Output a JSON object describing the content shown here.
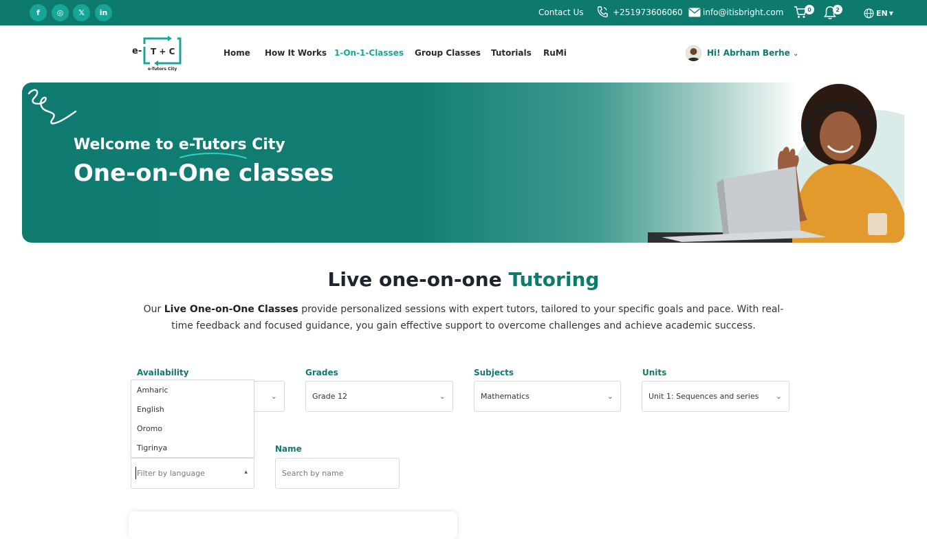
{
  "topbar": {
    "social": [
      {
        "icon": "facebook-icon",
        "glyph": "f"
      },
      {
        "icon": "instagram-icon",
        "glyph": "◎"
      },
      {
        "icon": "x-twitter-icon",
        "glyph": "𝕏"
      },
      {
        "icon": "linkedin-icon",
        "glyph": "in"
      }
    ],
    "contact_label": "Contact Us",
    "phone": "+251973606060",
    "email": "info@itisbright.com",
    "cart_count": "0",
    "notification_count": "2",
    "language": "EN"
  },
  "nav": {
    "logo_letters": "T + C",
    "logo_prefix": "e-",
    "logo_caption": "e-Tutors City",
    "items": [
      "Home",
      "How It Works",
      "1-On-1-Classes",
      "Group Classes",
      "Tutorials",
      "RuMi"
    ],
    "active_item": "1-On-1-Classes",
    "user_greeting": "Hi! Abrham Berhe"
  },
  "hero": {
    "welcome_prefix": "Welcome to ",
    "welcome_brand": "e-Tutors",
    "welcome_suffix": " City",
    "title": "One-on-One classes"
  },
  "section": {
    "title_main": "Live one-on-one ",
    "title_accent": "Tutoring",
    "desc_prefix": "Our ",
    "desc_bold": "Live One-on-One Classes",
    "desc_rest": " provide personalized sessions with expert tutors, tailored to your specific goals and pace. With real-time feedback and focused guidance, you gain effective support to overcome challenges and achieve academic success."
  },
  "filters": {
    "availability_label": "Availability",
    "grades_label": "Grades",
    "grades_value": "Grade 12",
    "subjects_label": "Subjects",
    "subjects_value": "Mathematics",
    "units_label": "Units",
    "units_value": "Unit 1: Sequences and series",
    "language_options": [
      "Amharic",
      "English",
      "Oromo",
      "Tigrinya"
    ],
    "language_placeholder": "Filter by language",
    "name_label": "Name",
    "name_placeholder": "Search by name"
  },
  "colors": {
    "brand": "#0e7a6e",
    "accent": "#19a598"
  }
}
